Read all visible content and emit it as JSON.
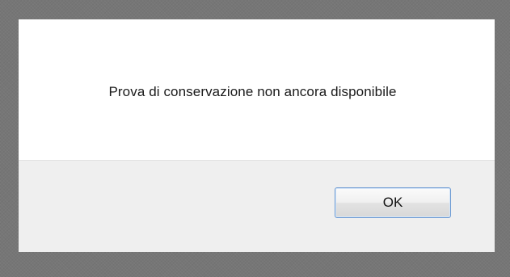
{
  "dialog": {
    "message": "Prova di conservazione non ancora disponibile",
    "ok_label": "OK"
  }
}
